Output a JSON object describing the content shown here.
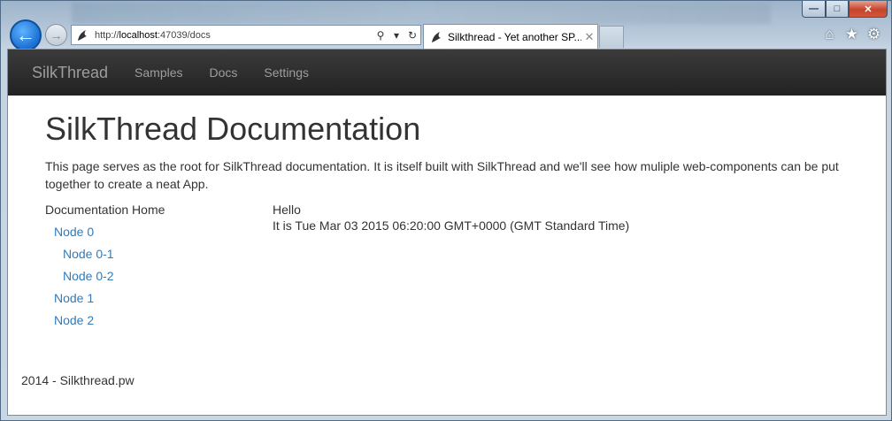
{
  "browser": {
    "address_prefix": "http://",
    "address_host": "localhost",
    "address_rest": ":47039/docs",
    "tab_title": "Silkthread - Yet another SP...",
    "win_min": "0",
    "win_max": "1",
    "win_close": "r"
  },
  "navbar": {
    "brand": "SilkThread",
    "links": [
      "Samples",
      "Docs",
      "Settings"
    ]
  },
  "page": {
    "title": "SilkThread Documentation",
    "intro": "This page serves as the root for SilkThread documentation. It is itself built with SilkThread and we'll see how muliple web-components can be put together to create a neat App.",
    "tree_root": "Documentation Home",
    "tree": [
      "Node 0",
      "Node 0-1",
      "Node 0-2",
      "Node 1",
      "Node 2"
    ],
    "main_line1": "Hello",
    "main_line2": "It is Tue Mar 03 2015 06:20:00 GMT+0000 (GMT Standard Time)",
    "footer": "2014 - Silkthread.pw"
  },
  "colors": {
    "link": "#337ab7",
    "navbar_bg": "#222222",
    "navbar_text": "#9d9d9d"
  },
  "icons": [
    "back-arrow-icon",
    "forward-arrow-icon",
    "silkthread-favicon-icon",
    "search-icon",
    "dropdown-icon",
    "refresh-icon",
    "close-icon",
    "home-icon",
    "star-icon",
    "gear-icon"
  ]
}
